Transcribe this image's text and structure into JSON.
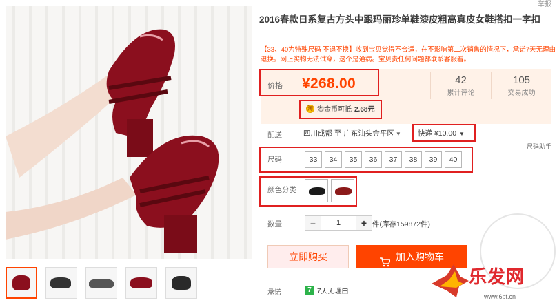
{
  "top": {
    "report_label": "举报"
  },
  "product": {
    "title": "2016春款日系复古方头中跟玛丽珍单鞋漆皮粗高真皮女鞋搭扣一字扣",
    "subtitle": "【33、40为特殊尺码 不退不换】收到宝贝觉得不合适，在不影响第二次销售的情况下，承诺7天无理由退换。网上实物无法试穿，这个是通病。宝贝责任何问题都联系客服看。"
  },
  "price": {
    "label": "价格",
    "value": "¥268.00"
  },
  "stats": [
    {
      "num": "42",
      "label": "累计评论"
    },
    {
      "num": "105",
      "label": "交易成功"
    }
  ],
  "coin": {
    "badge": "淘",
    "text_prefix": "淘金币可抵",
    "amount": "2.68元"
  },
  "delivery": {
    "label": "配送",
    "route": "四川成都 至 广东汕头金平区",
    "shipping": "快递 ¥10.00",
    "helper": "尺码助手"
  },
  "sizes": {
    "label": "尺码",
    "options": [
      "33",
      "34",
      "35",
      "36",
      "37",
      "38",
      "39",
      "40"
    ]
  },
  "colors": {
    "label": "颜色分类",
    "swatch_colors": [
      "#1a1a1a",
      "#8b1a1a"
    ]
  },
  "quantity": {
    "label": "数量",
    "value": "1",
    "minus": "−",
    "plus": "+",
    "stock": "件(库存159872件)"
  },
  "actions": {
    "buy_now": "立即购买",
    "add_cart": "加入购物车"
  },
  "promise": {
    "label": "承诺",
    "badge": "7",
    "text": "7天无理由"
  },
  "watermark": {
    "text": "乐发网",
    "url": "www.6pf.cn"
  },
  "colors_theme": {
    "accent": "#ff4400",
    "highlight_box": "#e02020",
    "price_bg": "#fff2e8",
    "shoe": "#8b0f1e"
  }
}
